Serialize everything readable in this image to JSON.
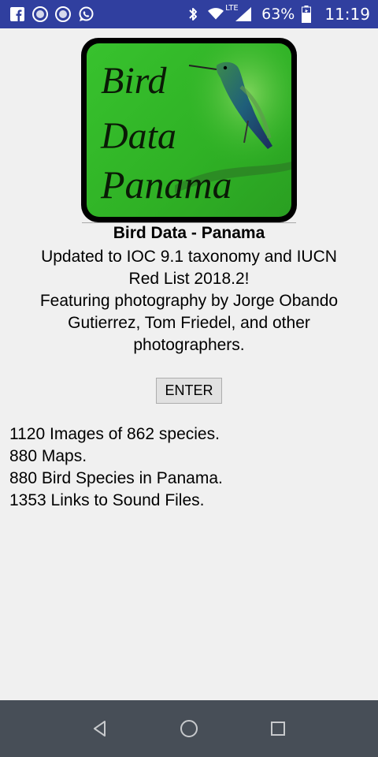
{
  "status_bar": {
    "battery": "63%",
    "time": "11:19",
    "network_label": "LTE",
    "icons": [
      "facebook-icon",
      "circle-app-icon",
      "circle-app-icon",
      "whatsapp-icon",
      "bluetooth-icon",
      "wifi-icon",
      "cell-signal-icon",
      "battery-icon"
    ]
  },
  "app": {
    "logo_text": [
      "Bird",
      "Data",
      "Panama"
    ],
    "title": "Bird Data - Panama",
    "description": [
      "Updated to IOC 9.1 taxonomy and IUCN",
      "Red List 2018.2!",
      "Featuring photography by Jorge Obando",
      "Gutierrez, Tom Friedel, and other",
      "photographers."
    ],
    "enter_label": "ENTER",
    "stats": [
      "1120 Images of 862 species.",
      "880 Maps.",
      "880 Bird Species in Panama.",
      "1353 Links to Sound Files."
    ]
  },
  "nav_bar": {
    "buttons": [
      "back-icon",
      "home-icon",
      "recents-icon"
    ]
  }
}
